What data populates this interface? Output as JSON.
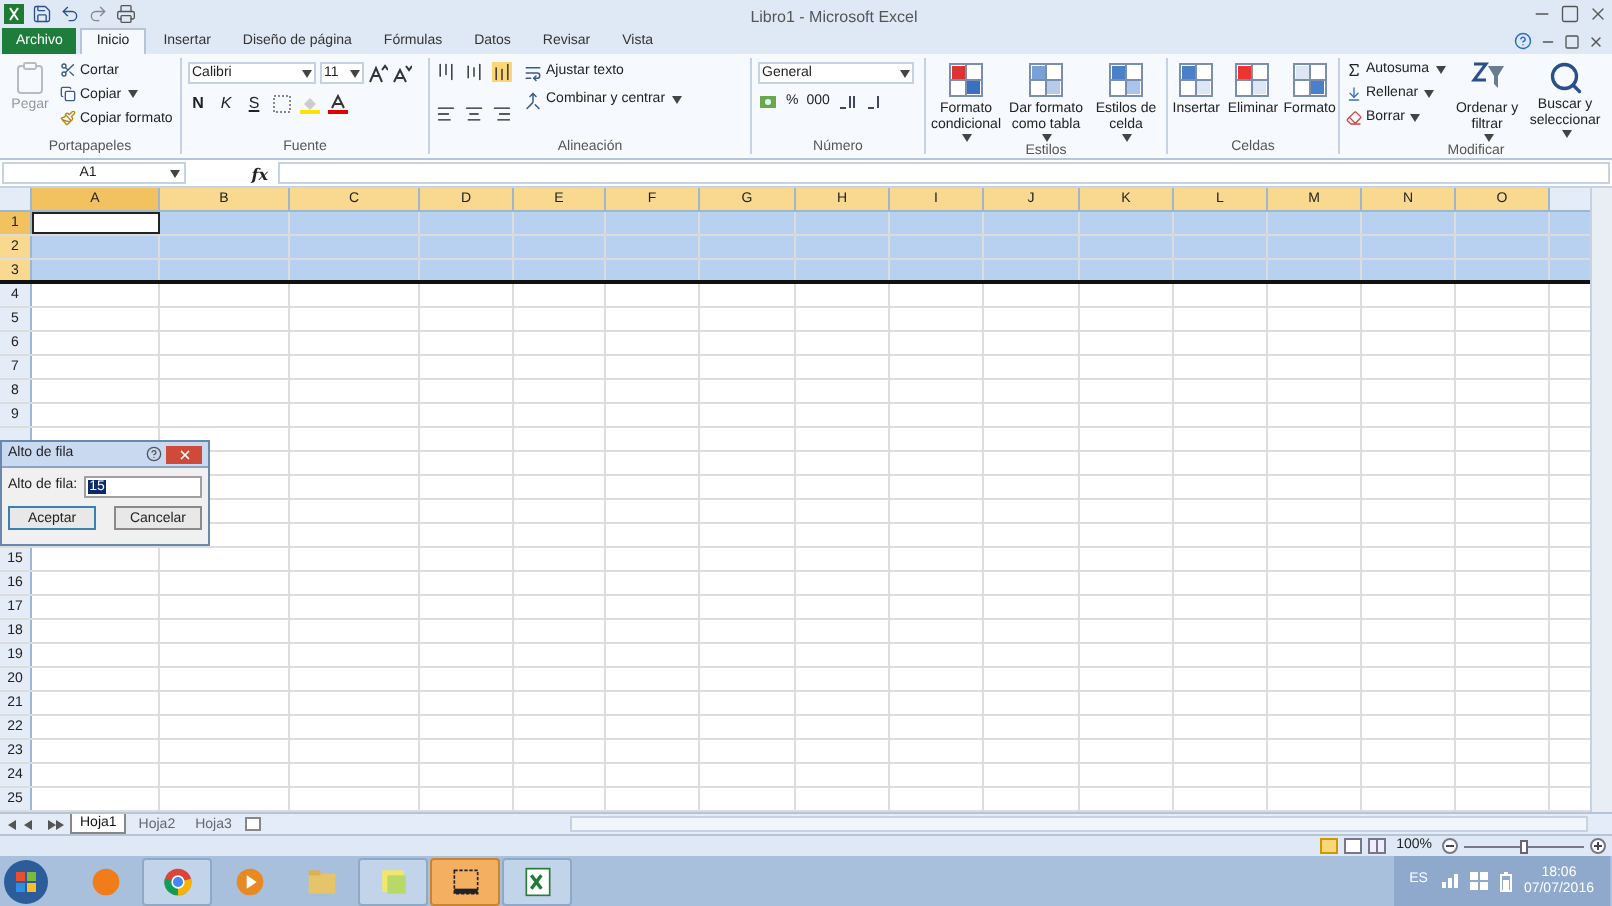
{
  "window": {
    "title": "Libro1 - Microsoft Excel"
  },
  "tabs": [
    {
      "label": "Archivo",
      "kind": "file",
      "selected": false
    },
    {
      "label": "Inicio",
      "kind": "tab",
      "selected": true
    },
    {
      "label": "Insertar",
      "kind": "tab",
      "selected": false
    },
    {
      "label": "Diseño de página",
      "kind": "tab",
      "selected": false
    },
    {
      "label": "Fórmulas",
      "kind": "tab",
      "selected": false
    },
    {
      "label": "Datos",
      "kind": "tab",
      "selected": false
    },
    {
      "label": "Revisar",
      "kind": "tab",
      "selected": false
    },
    {
      "label": "Vista",
      "kind": "tab",
      "selected": false
    }
  ],
  "clipboard": {
    "label": "Portapapeles",
    "paste": "Pegar",
    "paste_disabled": true,
    "cut": "Cortar",
    "copy": "Copiar",
    "format_painter": "Copiar formato"
  },
  "font": {
    "label": "Fuente",
    "name": "Calibri",
    "size": "11",
    "bold": "N",
    "italic": "K",
    "underline": "S"
  },
  "alignment": {
    "label": "Alineación",
    "wrap": "Ajustar texto",
    "merge": "Combinar y centrar"
  },
  "number": {
    "label": "Número",
    "format": "General",
    "percent": "%",
    "thousands": "000"
  },
  "styles": {
    "label": "Estilos",
    "buttons": [
      "Formato condicional",
      "Dar formato como tabla",
      "Estilos de celda"
    ]
  },
  "cells": {
    "label": "Celdas",
    "buttons": [
      "Insertar",
      "Eliminar",
      "Formato"
    ]
  },
  "editing": {
    "label": "Modificar",
    "autosum": "Autosuma",
    "fill": "Rellenar",
    "clear": "Borrar",
    "buttons": [
      "Ordenar y filtrar",
      "Buscar y seleccionar"
    ]
  },
  "formula_bar": {
    "name_box": "A1",
    "fx": "fx"
  },
  "columns": [
    {
      "label": "A",
      "selected": true,
      "active": true
    },
    {
      "label": "B",
      "selected": true,
      "active": false
    },
    {
      "label": "C",
      "selected": true,
      "active": false
    },
    {
      "label": "D",
      "selected": true,
      "active": false
    },
    {
      "label": "E",
      "selected": true,
      "active": false
    },
    {
      "label": "F",
      "selected": true,
      "active": false
    },
    {
      "label": "G",
      "selected": true,
      "active": false
    },
    {
      "label": "H",
      "selected": true,
      "active": false
    },
    {
      "label": "I",
      "selected": true,
      "active": false
    },
    {
      "label": "J",
      "selected": true,
      "active": false
    },
    {
      "label": "K",
      "selected": true,
      "active": false
    },
    {
      "label": "L",
      "selected": true,
      "active": false
    },
    {
      "label": "M",
      "selected": true,
      "active": false
    },
    {
      "label": "N",
      "selected": true,
      "active": false
    },
    {
      "label": "O",
      "selected": true,
      "active": false
    }
  ],
  "rows": [
    {
      "label": "1",
      "selected": true,
      "active": true,
      "resizing": false
    },
    {
      "label": "2",
      "selected": true,
      "active": false,
      "resizing": false
    },
    {
      "label": "3",
      "selected": true,
      "active": false,
      "resizing": true
    },
    {
      "label": "4",
      "selected": false,
      "active": false,
      "resizing": false
    },
    {
      "label": "5",
      "selected": false,
      "active": false,
      "resizing": false
    },
    {
      "label": "6",
      "selected": false,
      "active": false,
      "resizing": false
    },
    {
      "label": "7",
      "selected": false,
      "active": false,
      "resizing": false
    },
    {
      "label": "8",
      "selected": false,
      "active": false,
      "resizing": false
    },
    {
      "label": "9",
      "selected": false,
      "active": false,
      "resizing": false
    },
    {
      "selected": false,
      "active": false,
      "resizing": false
    },
    {
      "selected": false,
      "active": false,
      "resizing": false
    },
    {
      "selected": false,
      "active": false,
      "resizing": false
    },
    {
      "selected": false,
      "active": false,
      "resizing": false
    },
    {
      "selected": false,
      "active": false,
      "resizing": false
    },
    {
      "label": "15",
      "selected": false,
      "active": false,
      "resizing": false
    },
    {
      "label": "16",
      "selected": false,
      "active": false,
      "resizing": false
    },
    {
      "label": "17",
      "selected": false,
      "active": false,
      "resizing": false
    },
    {
      "label": "18",
      "selected": false,
      "active": false,
      "resizing": false
    },
    {
      "label": "19",
      "selected": false,
      "active": false,
      "resizing": false
    },
    {
      "label": "20",
      "selected": false,
      "active": false,
      "resizing": false
    },
    {
      "label": "21",
      "selected": false,
      "active": false,
      "resizing": false
    },
    {
      "label": "22",
      "selected": false,
      "active": false,
      "resizing": false
    },
    {
      "label": "23",
      "selected": false,
      "active": false,
      "resizing": false
    },
    {
      "label": "24",
      "selected": false,
      "active": false,
      "resizing": false
    },
    {
      "label": "25",
      "selected": false,
      "active": false,
      "resizing": false
    }
  ],
  "dialog": {
    "title": "Alto de fila",
    "field_label": "Alto de fila:",
    "value": "15",
    "buttons": [
      {
        "label": "Aceptar",
        "kind": "default"
      },
      {
        "label": "Cancelar",
        "kind": "normal"
      }
    ]
  },
  "sheets": [
    {
      "label": "Hoja1",
      "selected": true
    },
    {
      "label": "Hoja2",
      "selected": false
    },
    {
      "label": "Hoja3",
      "selected": false
    }
  ],
  "status_bar": {
    "zoom": "100%",
    "zoom_slider": {
      "level": 0.5
    }
  },
  "taskbar": {
    "apps": [
      {
        "kind": "orange-globe",
        "open": false,
        "selected": false
      },
      {
        "kind": "round-browser",
        "open": true,
        "selected": false
      },
      {
        "kind": "player",
        "open": false,
        "selected": false
      },
      {
        "kind": "folder",
        "open": false,
        "selected": false
      },
      {
        "kind": "notes",
        "open": true,
        "selected": false
      },
      {
        "kind": "capture",
        "open": true,
        "selected": true
      },
      {
        "kind": "spreadsheet",
        "open": true,
        "selected": false
      }
    ],
    "language": "ES",
    "time": "18:06",
    "date": "07/07/2016"
  }
}
